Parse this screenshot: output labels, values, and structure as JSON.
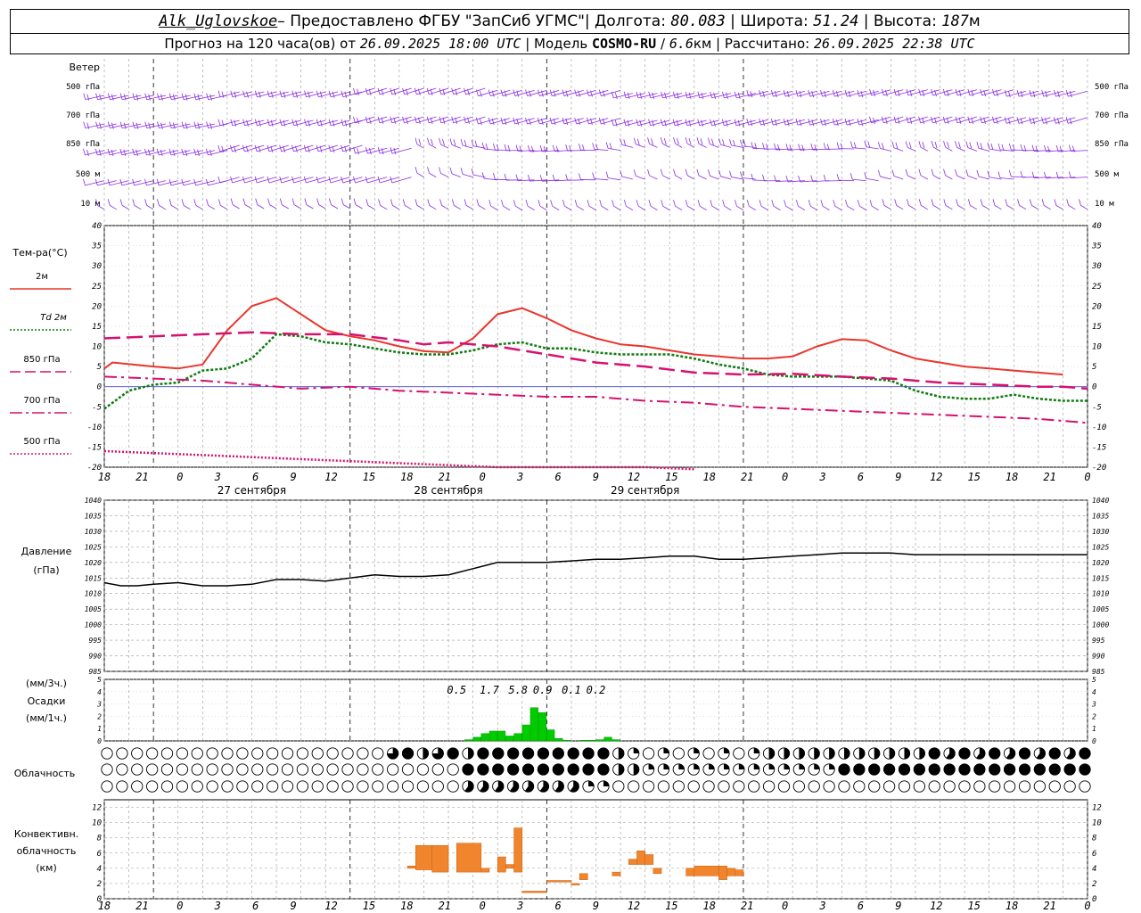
{
  "header": {
    "row1": [
      {
        "text": "Alk_Uglovskoe",
        "style": "italic-underline"
      },
      {
        "text": "–  Предоставлено ФГБУ \"ЗапСиб УГМС\"",
        "style": "normal"
      },
      {
        "text": "|  Долгота: ",
        "style": "normal"
      },
      {
        "text": "80.083",
        "style": "italic"
      },
      {
        "text": " | Широта: ",
        "style": "normal"
      },
      {
        "text": "51.24",
        "style": "italic"
      },
      {
        "text": " | Высота: ",
        "style": "normal"
      },
      {
        "text": "187",
        "style": "italic"
      },
      {
        "text": "м",
        "style": "normal"
      }
    ],
    "row2": [
      {
        "text": "Прогноз на 120 часа(ов) от ",
        "style": "normal"
      },
      {
        "text": "26.09.2025 18:00 UTC",
        "style": "italic"
      },
      {
        "text": "  | Модель ",
        "style": "normal"
      },
      {
        "text": "COSMO-RU",
        "style": "bold"
      },
      {
        "text": " / ",
        "style": "normal"
      },
      {
        "text": "6.6",
        "style": "italic"
      },
      {
        "text": "км | Рассчитано: ",
        "style": "normal"
      },
      {
        "text": "26.09.2025 22:38 UTC",
        "style": "italic"
      }
    ]
  },
  "chart_data": {
    "type": "meteogram",
    "time_axis": {
      "hours_from_start": [
        0,
        120
      ],
      "tick_labels": [
        "18",
        "21",
        "0",
        "3",
        "6",
        "9",
        "12",
        "15",
        "18",
        "21",
        "0",
        "3",
        "6",
        "9",
        "12",
        "15",
        "18",
        "21",
        "0",
        "3",
        "6",
        "9",
        "12",
        "15",
        "18",
        "21",
        "0"
      ],
      "day_labels": [
        {
          "text": "27 сентября",
          "at_hour": 18
        },
        {
          "text": "28 сентября",
          "at_hour": 42
        },
        {
          "text": "29 сентября",
          "at_hour": 66
        }
      ],
      "midnights_at_hour": [
        6,
        30,
        54,
        78
      ]
    },
    "wind": {
      "title": "Ветер",
      "levels": [
        "500 гПа",
        "700 гПа",
        "850 гПа",
        "500 м",
        "10  м"
      ],
      "color": "#8a2be2"
    },
    "temperature": {
      "title": "Тем-ра(°C)",
      "ylim": [
        -20,
        40
      ],
      "yticks": [
        -20,
        -15,
        -10,
        -5,
        0,
        5,
        10,
        15,
        20,
        25,
        30,
        35,
        40
      ],
      "legend": [
        {
          "label": "2м",
          "color": "#e8362d",
          "dash": "solid"
        },
        {
          "label": "Td  2м",
          "color": "#117a11",
          "dash": "dotted"
        },
        {
          "label": "850 гПа",
          "color": "#d6116f",
          "dash": "longdash"
        },
        {
          "label": "700 гПа",
          "color": "#d6116f",
          "dash": "dashdot"
        },
        {
          "label": "500 гПа",
          "color": "#d6116f",
          "dash": "dotted"
        }
      ],
      "series": [
        {
          "key": "t2m",
          "x": [
            0,
            1,
            3,
            6,
            9,
            12,
            15,
            18,
            21,
            24,
            27,
            30,
            33,
            36,
            39,
            42,
            45,
            48,
            51,
            54,
            57,
            60,
            63,
            66,
            69,
            72,
            75,
            78,
            81,
            84,
            87,
            90,
            93,
            96,
            99,
            102,
            105,
            108,
            111,
            114,
            117,
            120
          ],
          "y": [
            4.5,
            6,
            5.6,
            5,
            4.5,
            5.5,
            14,
            20,
            22,
            18,
            14,
            12.5,
            11.5,
            10,
            8.8,
            8.5,
            12,
            18,
            19.5,
            17,
            14,
            12,
            10.5,
            10,
            9,
            8,
            7.5,
            7,
            7,
            7.5,
            10,
            11.8,
            11.5,
            9,
            7,
            6,
            5,
            4.5,
            4,
            3.5,
            3
          ]
        },
        {
          "key": "td2m",
          "x": [
            0,
            3,
            6,
            9,
            12,
            15,
            18,
            21,
            24,
            27,
            30,
            33,
            36,
            39,
            42,
            45,
            48,
            51,
            54,
            57,
            60,
            63,
            66,
            69,
            72,
            75,
            78,
            81,
            84,
            87,
            90,
            93,
            96,
            99,
            102,
            105,
            108,
            111,
            114,
            117,
            120
          ],
          "y": [
            -5.5,
            -1,
            0.5,
            1,
            4,
            4.5,
            7,
            13,
            12.5,
            11,
            10.5,
            9.5,
            8.5,
            8,
            8,
            9,
            10.5,
            11,
            9.5,
            9.5,
            8.5,
            8,
            8,
            8,
            7,
            5.5,
            4.5,
            3,
            2.5,
            2.5,
            2.5,
            2,
            1.5,
            -1,
            -2.5,
            -3,
            -3,
            -2,
            -3,
            -3.5,
            -3.5
          ]
        },
        {
          "key": "t850",
          "x": [
            0,
            6,
            12,
            18,
            24,
            30,
            36,
            39,
            42,
            48,
            54,
            60,
            66,
            72,
            78,
            84,
            90,
            96,
            102,
            108,
            114,
            117,
            120
          ],
          "y": [
            12,
            12.5,
            13,
            13.5,
            13,
            13,
            11.5,
            10.5,
            11,
            10,
            8,
            6,
            5,
            3.5,
            3,
            3.2,
            2.5,
            2,
            1,
            0.5,
            0,
            0,
            -0.5
          ]
        },
        {
          "key": "t700",
          "x": [
            0,
            6,
            12,
            18,
            24,
            30,
            36,
            42,
            48,
            54,
            60,
            66,
            72,
            78,
            84,
            90,
            96,
            102,
            108,
            114,
            120
          ],
          "y": [
            2.5,
            2,
            1.5,
            0.5,
            -0.5,
            0,
            -1,
            -1.5,
            -2,
            -2.5,
            -2.5,
            -3.5,
            -4,
            -5,
            -5.5,
            -6,
            -6.5,
            -7,
            -7.5,
            -8,
            -9
          ]
        },
        {
          "key": "t500",
          "x": [
            0,
            6,
            12,
            18,
            24,
            30,
            36,
            42,
            48,
            54,
            60,
            66,
            72
          ],
          "y": [
            -16,
            -16.5,
            -17,
            -17.5,
            -18,
            -18.5,
            -19,
            -19.5,
            -20,
            -20,
            -20,
            -20,
            -20.5
          ]
        }
      ]
    },
    "pressure": {
      "title": "Давление",
      "unit": "(гПа)",
      "ylim": [
        985,
        1040
      ],
      "yticks": [
        985,
        990,
        995,
        1000,
        1005,
        1010,
        1015,
        1020,
        1025,
        1030,
        1035,
        1040
      ],
      "color": "#000000",
      "x": [
        0,
        2,
        4,
        6,
        9,
        12,
        15,
        18,
        21,
        24,
        27,
        30,
        33,
        36,
        39,
        42,
        45,
        48,
        51,
        54,
        57,
        60,
        63,
        66,
        69,
        72,
        75,
        78,
        81,
        84,
        87,
        90,
        93,
        96,
        99,
        102,
        105,
        108,
        111,
        114,
        117,
        120
      ],
      "y": [
        1013.5,
        1012.5,
        1012.5,
        1013,
        1013.5,
        1012.5,
        1012.5,
        1013,
        1014.5,
        1014.5,
        1014,
        1015,
        1016,
        1015.5,
        1015.5,
        1016,
        1018,
        1020,
        1020,
        1020,
        1020.5,
        1021,
        1021,
        1021.5,
        1022,
        1022,
        1021,
        1021,
        1021.5,
        1022,
        1022.5,
        1023,
        1023,
        1023,
        1022.5,
        1022.5,
        1022.5,
        1022.5,
        1022.5,
        1022.5,
        1022.5,
        1022.5
      ]
    },
    "precipitation": {
      "title": "Осадки",
      "units": [
        "(мм/3ч.)",
        "(мм/1ч.)"
      ],
      "ylim": [
        0,
        5
      ],
      "yticks": [
        0,
        1,
        2,
        3,
        4,
        5
      ],
      "color": "#00cc00",
      "bars_x": [
        44,
        45,
        46,
        47,
        48,
        49,
        50,
        51,
        52,
        53,
        54,
        55,
        56,
        58,
        59,
        60,
        61,
        62
      ],
      "bars_y": [
        0.1,
        0.3,
        0.6,
        0.8,
        0.8,
        0.4,
        0.6,
        1.3,
        2.7,
        2.3,
        0.9,
        0.2,
        0.05,
        0.05,
        0.05,
        0.1,
        0.3,
        0.1
      ],
      "totals_3h": [
        "0.5",
        "1.7",
        "5.8",
        "0.9",
        "0.1",
        "0.2"
      ],
      "totals_at_hour": [
        43,
        47,
        50.5,
        53.5,
        57,
        60
      ]
    },
    "cloudiness": {
      "title": "Облачность",
      "rows": 3,
      "slots_per_row": 66,
      "note": "values 0..1 per slot, rows: high, middle, low"
    },
    "convective": {
      "title": "Конвективн. облачность (км)",
      "ylim": [
        0,
        13
      ],
      "yticks": [
        0,
        2,
        4,
        6,
        8,
        10,
        12
      ],
      "color": "#f0852d",
      "bars": [
        {
          "x0": 37,
          "x1": 38,
          "bottom": 4,
          "top": 4.3
        },
        {
          "x0": 38,
          "x1": 40,
          "bottom": 3.8,
          "top": 7
        },
        {
          "x0": 40,
          "x1": 42,
          "bottom": 3.5,
          "top": 7
        },
        {
          "x0": 43,
          "x1": 46,
          "bottom": 3.5,
          "top": 7.3
        },
        {
          "x0": 46,
          "x1": 47,
          "bottom": 3.5,
          "top": 4
        },
        {
          "x0": 48,
          "x1": 49,
          "bottom": 3.5,
          "top": 5.5
        },
        {
          "x0": 49,
          "x1": 50,
          "bottom": 4,
          "top": 4.5
        },
        {
          "x0": 50,
          "x1": 51,
          "bottom": 3.5,
          "top": 9.3
        },
        {
          "x0": 51,
          "x1": 54,
          "bottom": 0.8,
          "top": 1
        },
        {
          "x0": 54,
          "x1": 57,
          "bottom": 2.2,
          "top": 2.4
        },
        {
          "x0": 57,
          "x1": 58,
          "bottom": 1.8,
          "top": 2
        },
        {
          "x0": 58,
          "x1": 59,
          "bottom": 2.5,
          "top": 3.3
        },
        {
          "x0": 62,
          "x1": 63,
          "bottom": 3,
          "top": 3.5
        },
        {
          "x0": 64,
          "x1": 65,
          "bottom": 4.5,
          "top": 5.2
        },
        {
          "x0": 65,
          "x1": 66,
          "bottom": 4.5,
          "top": 6.3
        },
        {
          "x0": 66,
          "x1": 67,
          "bottom": 4.5,
          "top": 5.8
        },
        {
          "x0": 67,
          "x1": 68,
          "bottom": 3.3,
          "top": 4
        },
        {
          "x0": 71,
          "x1": 72,
          "bottom": 3,
          "top": 4
        },
        {
          "x0": 72,
          "x1": 75,
          "bottom": 3,
          "top": 4.3
        },
        {
          "x0": 75,
          "x1": 76,
          "bottom": 2.5,
          "top": 4.3
        },
        {
          "x0": 76,
          "x1": 77,
          "bottom": 3,
          "top": 4
        },
        {
          "x0": 77,
          "x1": 78,
          "bottom": 3,
          "top": 3.8
        }
      ]
    }
  }
}
